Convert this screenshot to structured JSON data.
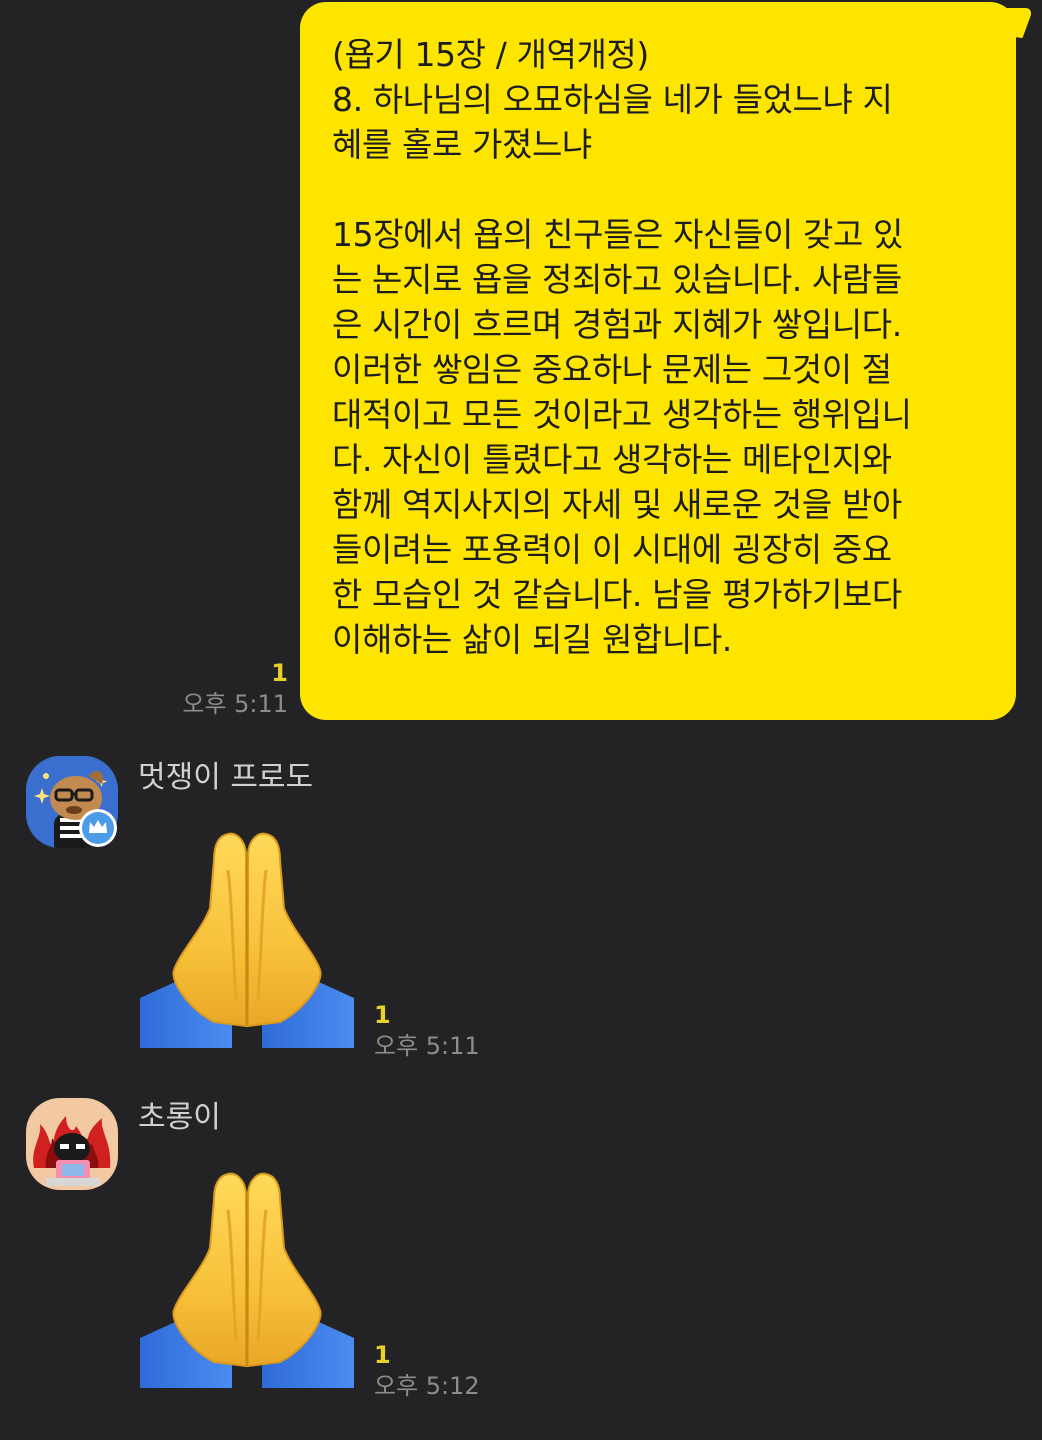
{
  "outgoing": {
    "heading": "(욥기 15장 / 개역개정)",
    "verse": "8. 하나님의 오묘하심을 네가 들었느냐 지\n혜를 홀로 가졌느냐",
    "body": "15장에서 욥의 친구들은 자신들이 갖고 있\n는 논지로 욥을 정죄하고 있습니다. 사람들\n은 시간이 흐르며 경험과 지혜가 쌓입니다.\n이러한 쌓임은 중요하나 문제는 그것이 절\n대적이고 모든 것이라고 생각하는 행위입니\n다. 자신이 틀렸다고 생각하는 메타인지와\n함께 역지사지의 자세 및 새로운 것을 받아\n들이려는 포용력이 이 시대에 굉장히 중요\n한 모습인 것 같습니다. 남을 평가하기보다\n이해하는 삶이 되길 원합니다.",
    "unread": "1",
    "time": "오후 5:11"
  },
  "messages": [
    {
      "sender": "멋쟁이 프로도",
      "avatar_icon": "frodo-dog-avatar-icon",
      "badge_icon": "crown-icon",
      "content_icon": "folded-hands-emoji-icon",
      "unread": "1",
      "time": "오후 5:11"
    },
    {
      "sender": "초롱이",
      "avatar_icon": "choroong-avatar-icon",
      "content_icon": "folded-hands-emoji-icon",
      "unread": "1",
      "time": "오후 5:12"
    }
  ],
  "colors": {
    "background": "#232325",
    "my_bubble": "#FEE500",
    "unread": "#E8D22A",
    "time": "#8C8C8E",
    "sender": "#D0D0D2"
  }
}
